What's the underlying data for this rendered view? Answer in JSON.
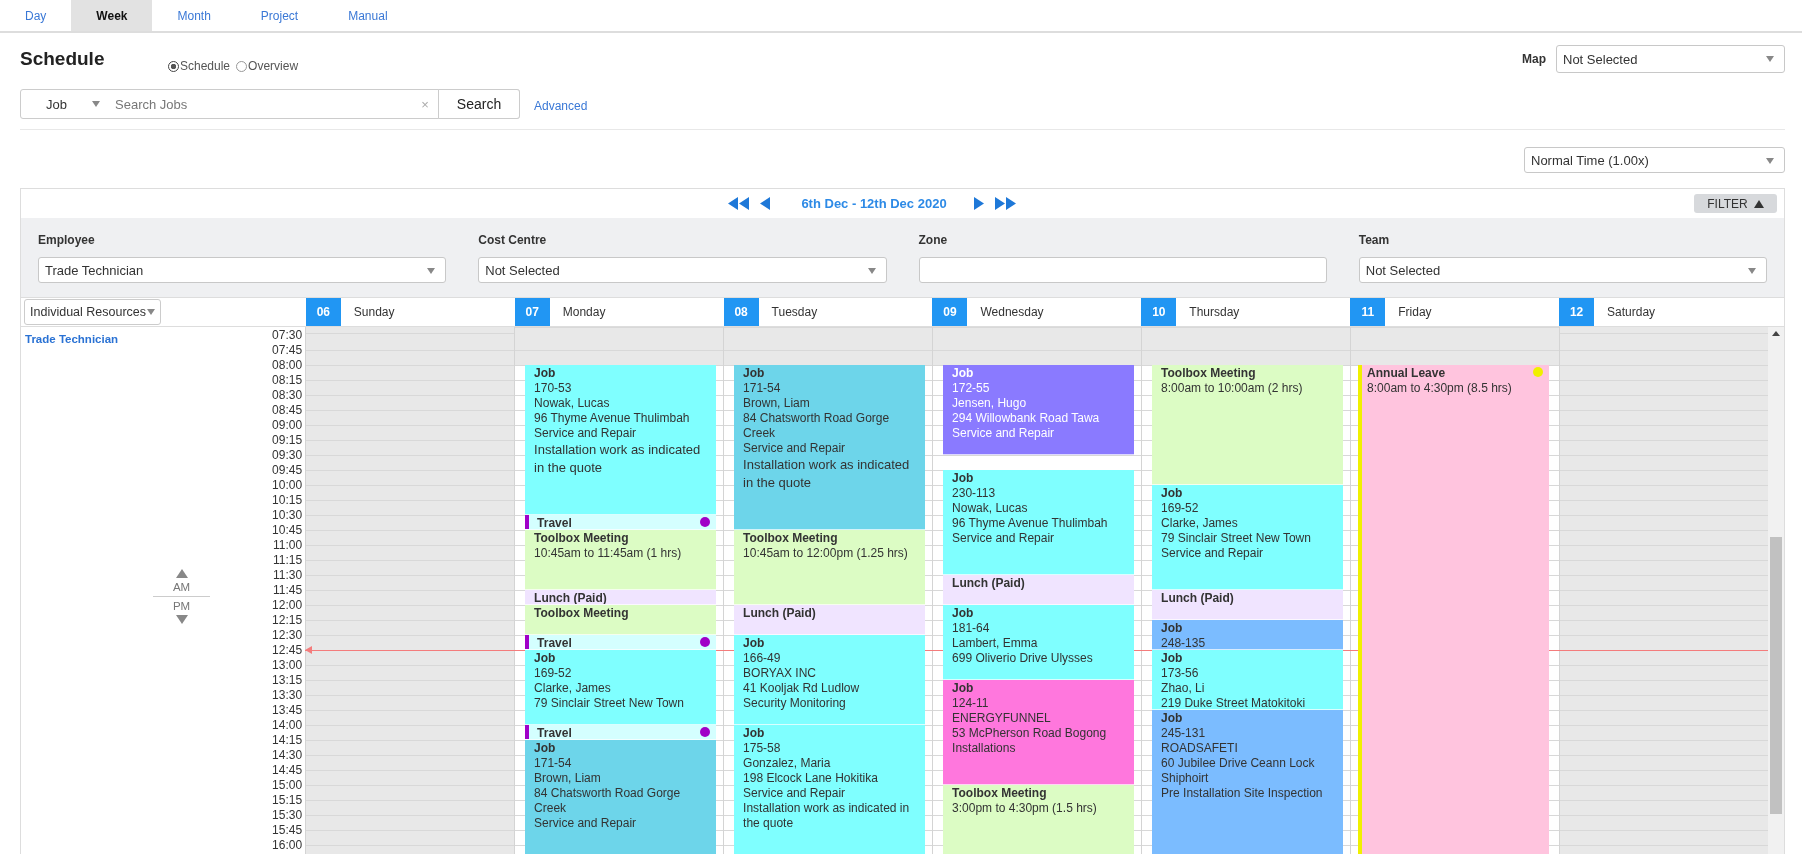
{
  "tabs": [
    {
      "label": "Day",
      "selected": false
    },
    {
      "label": "Week",
      "selected": true
    },
    {
      "label": "Month",
      "selected": false
    },
    {
      "label": "Project",
      "selected": false
    },
    {
      "label": "Manual",
      "selected": false
    }
  ],
  "title": "Schedule",
  "view_options": [
    {
      "label": "Schedule",
      "selected": true
    },
    {
      "label": "Overview",
      "selected": false
    }
  ],
  "map": {
    "label": "Map",
    "value": "Not Selected"
  },
  "search": {
    "type": "Job",
    "placeholder": "Search Jobs",
    "clear": "×",
    "button": "Search",
    "advanced": "Advanced"
  },
  "time_scale": "Normal Time (1.00x)",
  "nav": {
    "range": "6th Dec - 12th Dec 2020",
    "filter": "FILTER"
  },
  "filters": [
    {
      "label": "Employee",
      "kind": "select",
      "value": "Trade Technician"
    },
    {
      "label": "Cost Centre",
      "kind": "select",
      "value": "Not Selected"
    },
    {
      "label": "Zone",
      "kind": "text"
    },
    {
      "label": "Team",
      "kind": "select",
      "value": "Not Selected"
    }
  ],
  "resources": {
    "mode": "Individual Resources",
    "items": [
      "Trade Technician"
    ]
  },
  "am_pm": [
    "AM",
    "PM"
  ],
  "calendar": {
    "times": [
      "07:30",
      "07:45",
      "08:00",
      "08:15",
      "08:30",
      "08:45",
      "09:00",
      "09:15",
      "09:30",
      "09:45",
      "10:00",
      "10:15",
      "10:30",
      "10:45",
      "11:00",
      "11:15",
      "11:30",
      "11:45",
      "12:00",
      "12:15",
      "12:30",
      "12:45",
      "13:00",
      "13:15",
      "13:30",
      "13:45",
      "14:00",
      "14:15",
      "14:30",
      "14:45",
      "15:00",
      "15:15",
      "15:30",
      "15:45",
      "16:00"
    ],
    "days": [
      {
        "num": "06",
        "name": "Sunday",
        "working": false
      },
      {
        "num": "07",
        "name": "Monday",
        "working": true,
        "events": [
          {
            "kind": "job",
            "color": "#7fffff",
            "title": "Job",
            "lines": [
              "170-53",
              "Nowak, Lucas",
              "96 Thyme Avenue Thulimbah",
              "Service and Repair"
            ],
            "note": "Installation work as indicated in the quote"
          },
          {
            "kind": "travel",
            "color": "#d4ffff",
            "title": "Travel"
          },
          {
            "kind": "meeting",
            "color": "#dcfcc4",
            "title": "Toolbox Meeting",
            "lines": [
              "10:45am to 11:45am (1 hrs)"
            ]
          },
          {
            "kind": "lunch",
            "color": "#f0e4ff",
            "title": "Lunch (Paid)"
          },
          {
            "kind": "meeting",
            "color": "#dcfcc4",
            "title": "Toolbox Meeting"
          },
          {
            "kind": "travel",
            "color": "#d4ffff",
            "title": "Travel"
          },
          {
            "kind": "job",
            "color": "#7fffff",
            "title": "Job",
            "lines": [
              "169-52",
              "Clarke, James",
              "79 Sinclair Street New Town"
            ]
          },
          {
            "kind": "travel",
            "color": "#d4ffff",
            "title": "Travel"
          },
          {
            "kind": "job",
            "color": "#6dd5ea",
            "title": "Job",
            "lines": [
              "171-54",
              "Brown, Liam",
              "84 Chatsworth Road Gorge Creek",
              "Service and Repair"
            ]
          }
        ]
      },
      {
        "num": "08",
        "name": "Tuesday",
        "working": true,
        "events": [
          {
            "kind": "job",
            "color": "#6dd5ea",
            "title": "Job",
            "lines": [
              "171-54",
              "Brown, Liam",
              "84 Chatsworth Road Gorge Creek",
              "Service and Repair"
            ],
            "note": "Installation work as indicated in the quote"
          },
          {
            "kind": "meeting",
            "color": "#dcfcc4",
            "title": "Toolbox Meeting",
            "lines": [
              "10:45am to 12:00pm (1.25 hrs)"
            ]
          },
          {
            "kind": "lunch",
            "color": "#f0e4ff",
            "title": "Lunch (Paid)"
          },
          {
            "kind": "job",
            "color": "#7fffff",
            "title": "Job",
            "lines": [
              "166-49",
              "BORYAX INC",
              "41 Kooljak Rd Ludlow",
              "Security Monitoring"
            ]
          },
          {
            "kind": "job",
            "color": "#7fffff",
            "title": "Job",
            "lines": [
              "175-58",
              "Gonzalez, Maria",
              "198 Elcock Lane Hokitika",
              "Service and Repair",
              "Installation work as indicated in the quote"
            ]
          }
        ]
      },
      {
        "num": "09",
        "name": "Wednesday",
        "working": true,
        "events": [
          {
            "kind": "job",
            "color": "#8a7aff",
            "light_text": true,
            "title": "Job",
            "lines": [
              "172-55",
              "Jensen, Hugo",
              "294 Willowbank Road Tawa",
              "Service and Repair"
            ]
          },
          {
            "kind": "job",
            "color": "#7fffff",
            "title": "Job",
            "lines": [
              "230-113",
              "Nowak, Lucas",
              "96 Thyme Avenue Thulimbah",
              "Service and Repair"
            ]
          },
          {
            "kind": "lunch",
            "color": "#f0e4ff",
            "title": "Lunch (Paid)"
          },
          {
            "kind": "job",
            "color": "#7fffff",
            "title": "Job",
            "lines": [
              "181-64",
              "Lambert, Emma",
              "699 Oliverio Drive Ulysses"
            ]
          },
          {
            "kind": "job",
            "color": "#ff77dd",
            "title": "Job",
            "lines": [
              "124-11",
              "ENERGYFUNNEL",
              "53 McPherson Road Bogong",
              "Installations"
            ]
          },
          {
            "kind": "meeting",
            "color": "#dcfcc4",
            "title": "Toolbox Meeting",
            "lines": [
              "3:00pm to 4:30pm (1.5 hrs)"
            ]
          }
        ]
      },
      {
        "num": "10",
        "name": "Thursday",
        "working": true,
        "events": [
          {
            "kind": "meeting",
            "color": "#dcfcc4",
            "title": "Toolbox Meeting",
            "lines": [
              "8:00am to 10:00am (2 hrs)"
            ]
          },
          {
            "kind": "job",
            "color": "#7fffff",
            "title": "Job",
            "lines": [
              "169-52",
              "Clarke, James",
              "79 Sinclair Street New Town",
              "Service and Repair"
            ]
          },
          {
            "kind": "lunch",
            "color": "#f0e4ff",
            "title": "Lunch (Paid)"
          },
          {
            "kind": "job",
            "color": "#7bbcff",
            "title": "Job",
            "lines": [
              "248-135"
            ]
          },
          {
            "kind": "job",
            "color": "#7fffff",
            "title": "Job",
            "lines": [
              "173-56",
              "Zhao, Li",
              "219 Duke Street Matokitoki"
            ]
          },
          {
            "kind": "job",
            "color": "#7bbcff",
            "title": "Job",
            "lines": [
              "245-131",
              "ROADSAFETI",
              "60 Jubilee Drive Ceann Lock Shiphoirt",
              "Pre Installation Site Inspection"
            ]
          }
        ]
      },
      {
        "num": "11",
        "name": "Friday",
        "working": true,
        "events": [
          {
            "kind": "leave",
            "color": "#ffc4de",
            "title": "Annual Leave",
            "lines": [
              "8:00am to 4:30pm (8.5 hrs)"
            ]
          }
        ]
      },
      {
        "num": "12",
        "name": "Saturday",
        "working": false
      }
    ]
  }
}
